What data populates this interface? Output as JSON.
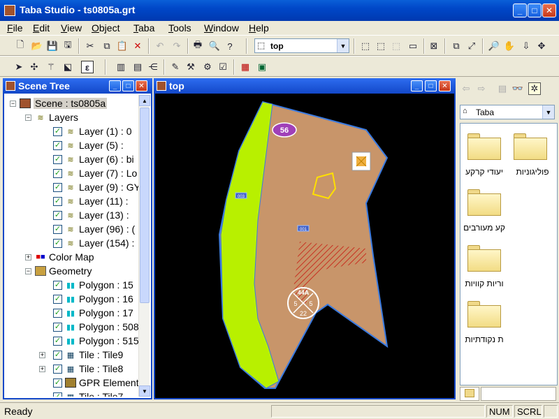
{
  "app": {
    "title": "Taba Studio - ts0805a.grt"
  },
  "menu": [
    "File",
    "Edit",
    "View",
    "Object",
    "Taba",
    "Tools",
    "Window",
    "Help"
  ],
  "menu_underline": [
    "F",
    "E",
    "V",
    "O",
    "T",
    "T",
    "W",
    "H"
  ],
  "toolbar": {
    "view_combo_value": "top"
  },
  "scene_tree": {
    "title": "Scene Tree",
    "items": [
      {
        "label": "Scene : ts0805a",
        "level": 0
      },
      {
        "label": "Layers",
        "level": 1
      },
      {
        "label": "Layer (1) : 0",
        "level": 2
      },
      {
        "label": "Layer (5) :",
        "level": 2
      },
      {
        "label": "Layer (6) : bi",
        "level": 2
      },
      {
        "label": "Layer (7) : Lo",
        "level": 2
      },
      {
        "label": "Layer (9) : GY",
        "level": 2
      },
      {
        "label": "Layer (11) :",
        "level": 2
      },
      {
        "label": "Layer (13) :",
        "level": 2
      },
      {
        "label": "Layer (96) : (",
        "level": 2
      },
      {
        "label": "Layer (154) :",
        "level": 2
      },
      {
        "label": "Color Map",
        "level": 1
      },
      {
        "label": "Geometry",
        "level": 1
      },
      {
        "label": "Polygon : 15",
        "level": 2
      },
      {
        "label": "Polygon : 16",
        "level": 2
      },
      {
        "label": "Polygon : 17",
        "level": 2
      },
      {
        "label": "Polygon : 508",
        "level": 2
      },
      {
        "label": "Polygon : 515",
        "level": 2
      },
      {
        "label": "Tile : Tile9",
        "level": 2
      },
      {
        "label": "Tile : Tile8",
        "level": 2
      },
      {
        "label": "GPR Element",
        "level": 2
      },
      {
        "label": "Tile : Tile7",
        "level": 2
      }
    ]
  },
  "view": {
    "title": "top",
    "labels": {
      "badge": "56",
      "tag1": "003",
      "tag2": "001",
      "circle_top": "44A",
      "circle_left": "5",
      "circle_right": "5",
      "circle_bottom": "22"
    }
  },
  "browser": {
    "combo_value": "Taba",
    "folders": [
      {
        "label": "יעודי קרקע"
      },
      {
        "label": "פוליגוניות"
      },
      {
        "label": "קע מעורבים"
      },
      {
        "label": "וריות קוויות"
      },
      {
        "label": "ת נקודתיות"
      }
    ]
  },
  "status": {
    "text": "Ready",
    "num": "NUM",
    "scrl": "SCRL"
  },
  "colors": {
    "parcel": "#c8956a",
    "road": "#b8f000",
    "canvas": "#000000",
    "title_blue": "#0a5fd8"
  }
}
